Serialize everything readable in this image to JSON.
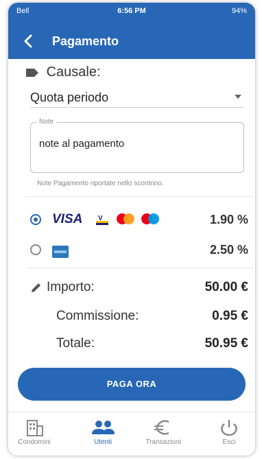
{
  "statusbar": {
    "carrier": "Bell",
    "time": "6:56 PM",
    "battery": "94%"
  },
  "appbar": {
    "title": "Pagamento"
  },
  "form": {
    "causale_label": "Causale:",
    "causale_value": "Quota periodo",
    "notes_legend": "Note",
    "notes_value": "note al pagamento",
    "notes_hint": "Note Pagamento riportate nello scontrino."
  },
  "payment_methods": [
    {
      "brand_text": "VISA",
      "percent": "1.90 %",
      "selected": true
    },
    {
      "percent": "2.50 %",
      "selected": false
    }
  ],
  "summary": {
    "importo_label": "Importo:",
    "importo_value": "50.00 €",
    "commissione_label": "Commissione:",
    "commissione_value": "0.95 €",
    "totale_label": "Totale:",
    "totale_value": "50.95 €"
  },
  "cta": {
    "label": "PAGA ORA"
  },
  "tabs": [
    {
      "label": "Condomini",
      "icon": "building-icon"
    },
    {
      "label": "Utenti",
      "icon": "users-icon",
      "active": true
    },
    {
      "label": "Transazioni",
      "icon": "euro-icon"
    },
    {
      "label": "Esci",
      "icon": "power-icon"
    }
  ],
  "colors": {
    "primary": "#2867b6",
    "text": "#333333"
  }
}
